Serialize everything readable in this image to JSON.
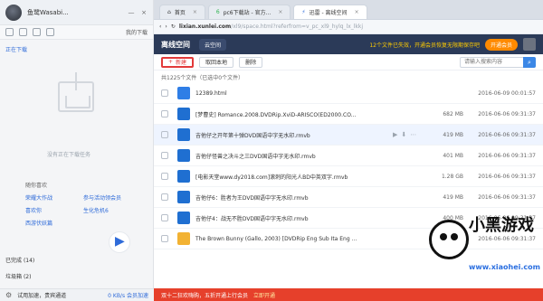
{
  "left": {
    "profile": {
      "name": "鱼鹭Wasabi..."
    },
    "toolbar_label": "我的下载",
    "section_title": "正在下载",
    "empty_text": "没有正在下载任务",
    "suggest": {
      "title": "随你喜欢",
      "items": [
        "荣耀大作战",
        "参与活动领会员",
        "喜欢你",
        "生化危机6",
        "西游伏妖篇"
      ]
    },
    "completed": {
      "label": "已完成",
      "count": "(14)"
    },
    "trash": {
      "label": "垃圾箱",
      "count": "(2)"
    },
    "status": {
      "text": "试用加速，贵宾通道",
      "speed": "0 KB/s 会员加速"
    }
  },
  "browser": {
    "tabs": [
      {
        "label": "首页",
        "icon": "home-icon"
      },
      {
        "label": "pc6下载站 - 官方...",
        "icon": "pc6-icon"
      },
      {
        "label": "迅雷 - 离线空间",
        "icon": "thunder-icon",
        "active": true
      }
    ],
    "url": {
      "host": "lixian.xunlei.com",
      "path": "/xl9/space.html?referfrom=v_pc_xl9_hylq_lx_lkkj"
    },
    "header": {
      "logo": "离线空间",
      "cloud": "云空间",
      "promo": "12个文件已失效，开通会员恢复无限期保存吧",
      "open_member": "开通会员"
    },
    "actions": {
      "new": "新建",
      "download_local": "取回本地",
      "delete": "删除",
      "search_placeholder": "请输入搜索内容"
    },
    "count_text": "共1225个文件（已选中0个文件）",
    "files": [
      {
        "name": "12389.html",
        "size": "",
        "date": "2016-06-09 00:01:57",
        "type": "web"
      },
      {
        "name": "[梦曹史] Romance.2008.DVDRip.XviD-ARISCO(ED2000.CO...",
        "size": "682 MB",
        "date": "2016-06-06 09:31:37",
        "type": "video"
      },
      {
        "name": "吉他仔之开年第十弹DVD国语中字无水印.rmvb",
        "size": "419 MB",
        "date": "2016-06-06 09:31:37",
        "type": "video",
        "highlight": true
      },
      {
        "name": "吉他仔怪兽之决斗之三DVD国语中字无水印.rmvb",
        "size": "401 MB",
        "date": "2016-06-06 09:31:37",
        "type": "video"
      },
      {
        "name": "[电影天堂www.dy2018.com]滚刺的阳光人BD中英双字.rmvb",
        "size": "1.28 GB",
        "date": "2016-06-06 09:31:37",
        "type": "video"
      },
      {
        "name": "吉他仔6：胜者为王DVD国语中字无水印.rmvb",
        "size": "419 MB",
        "date": "2016-06-06 09:31:37",
        "type": "video"
      },
      {
        "name": "吉他仔4：战无不胜DVD国语中字无水印.rmvb",
        "size": "400 MB",
        "date": "2016-06-06 09:31:37",
        "type": "video"
      },
      {
        "name": "The Brown Bunny (Gallo, 2003) [DVDRip Eng Sub Ita Eng ...",
        "size": "",
        "date": "2016-06-06 09:31:37",
        "type": "folder"
      }
    ],
    "bottom_promo": {
      "text": "双十二狂欢嗨购，五折开通上行会员",
      "cta": "立即开通"
    }
  },
  "watermark": {
    "big": "小黑游戏",
    "site": "www.xiaohei.com"
  }
}
